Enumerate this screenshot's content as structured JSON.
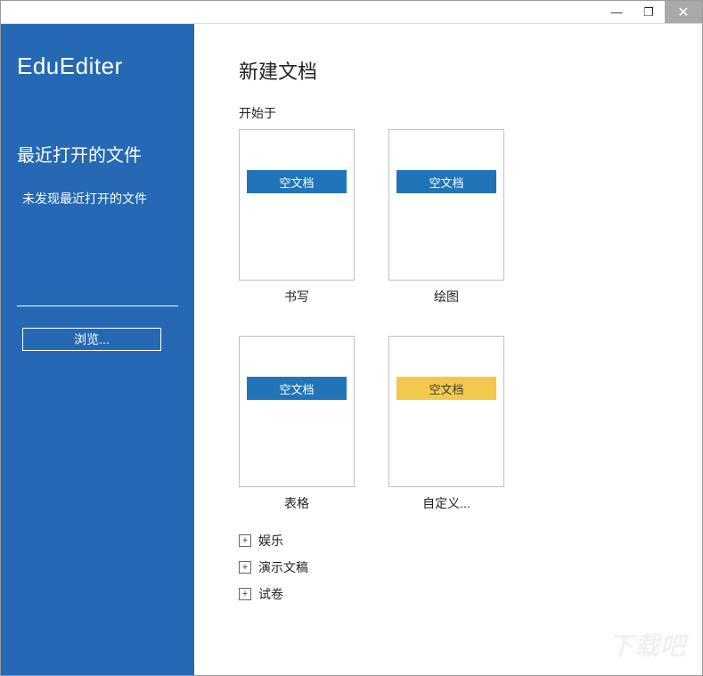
{
  "titlebar": {
    "minimize": "—",
    "maximize": "❐",
    "close": "✕"
  },
  "sidebar": {
    "app_name": "EduEditer",
    "recent_title": "最近打开的文件",
    "recent_empty": "未发现最近打开的文件",
    "browse_label": "浏览..."
  },
  "main": {
    "title": "新建文档",
    "start_label": "开始于",
    "templates": [
      {
        "band_text": "空文档",
        "label": "书写",
        "band_color": "blue"
      },
      {
        "band_text": "空文档",
        "label": "绘图",
        "band_color": "blue"
      },
      {
        "band_text": "空文档",
        "label": "表格",
        "band_color": "blue"
      },
      {
        "band_text": "空文档",
        "label": "自定义...",
        "band_color": "yellow"
      }
    ],
    "categories": [
      {
        "label": "娱乐"
      },
      {
        "label": "演示文稿"
      },
      {
        "label": "试卷"
      }
    ]
  },
  "watermark": "下载吧"
}
